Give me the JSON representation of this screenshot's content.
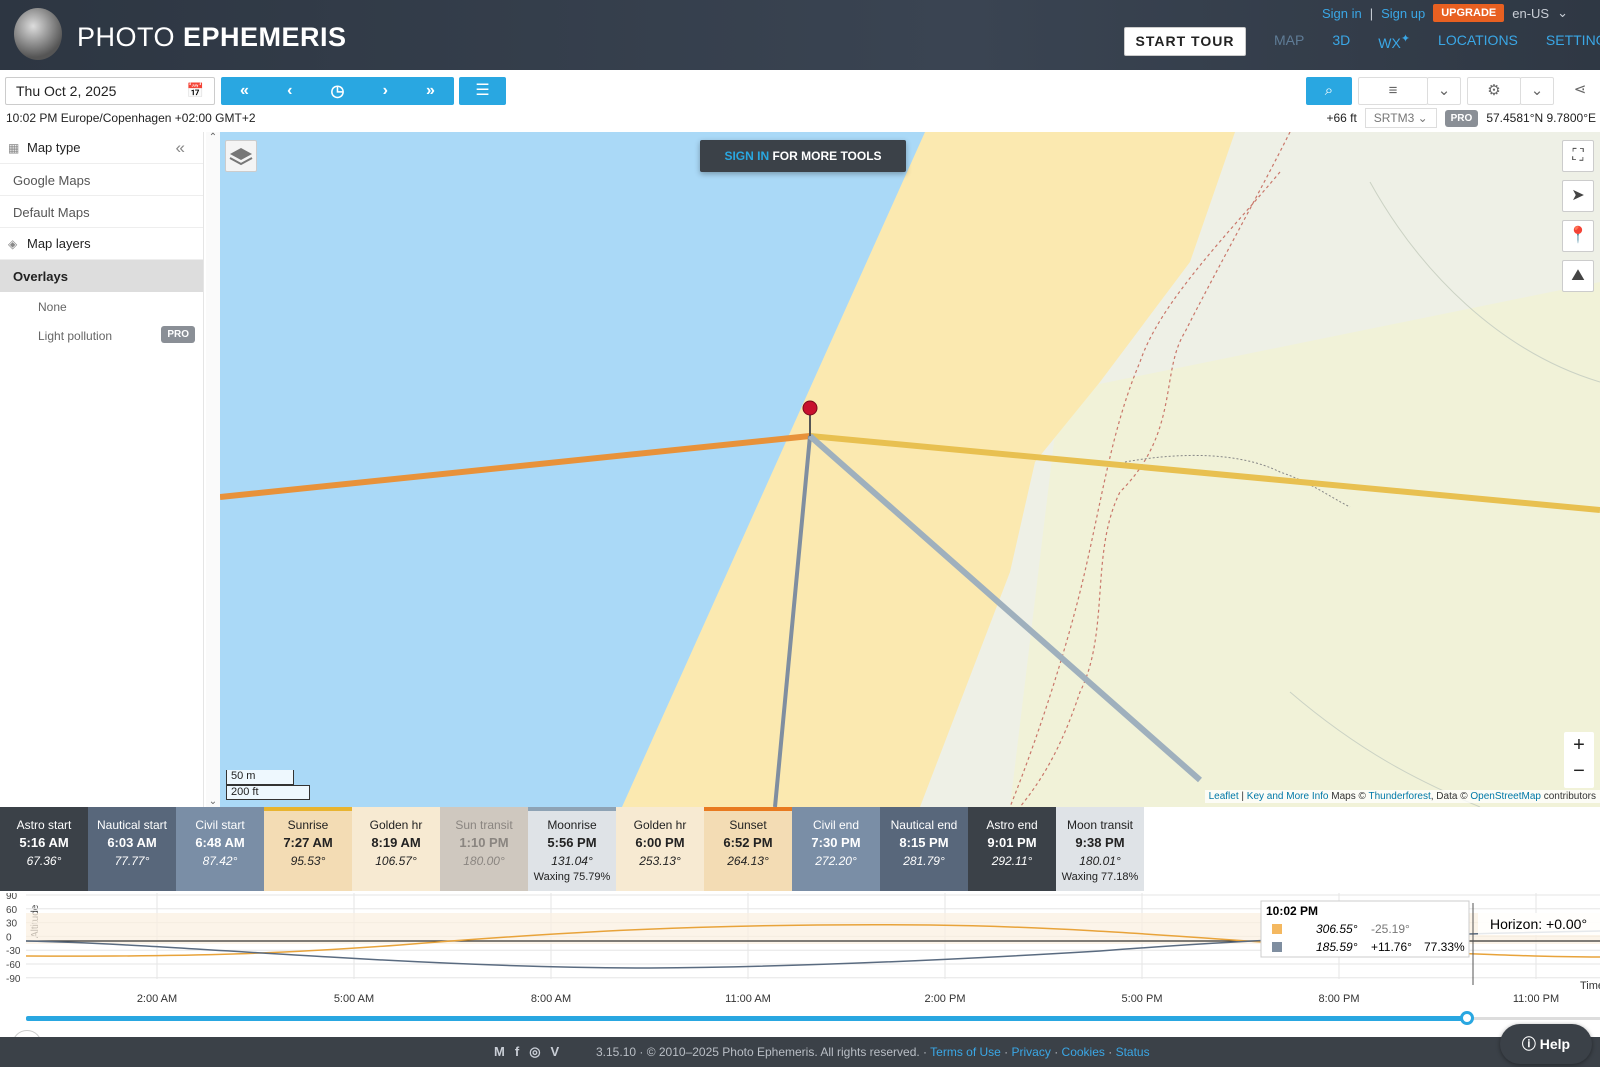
{
  "header": {
    "logo_light": "PHOTO",
    "logo_bold": "EPHEMERIS",
    "sign_in": "Sign in",
    "sep": "|",
    "sign_up": "Sign up",
    "upgrade": "UPGRADE",
    "language": "en-US",
    "start_tour": "START TOUR",
    "nav": {
      "map": "MAP",
      "three_d": "3D",
      "wx": "WX",
      "locations": "LOCATIONS",
      "settings": "SETTINGS"
    }
  },
  "toolbar": {
    "date": "Thu Oct 2, 2025",
    "timezone_line": "10:02 PM Europe/Copenhagen +02:00 GMT+2",
    "elevation": "+66 ft",
    "dem": "SRTM3",
    "pro": "PRO",
    "coords": "57.4581°N 9.7800°E"
  },
  "sidebar": {
    "map_type": "Map type",
    "google_maps": "Google Maps",
    "default_maps": "Default Maps",
    "map_layers": "Map layers",
    "overlays": "Overlays",
    "none": "None",
    "light_pollution": "Light pollution",
    "pro": "PRO"
  },
  "map": {
    "signin_prefix": "SIGN IN",
    "signin_suffix": " FOR MORE TOOLS",
    "scale_m": "50 m",
    "scale_ft": "200 ft",
    "attribution": {
      "leaflet": "Leaflet",
      "sep": " | ",
      "key": "Key and More Info",
      "maps": " Maps © ",
      "thunderforest": "Thunderforest",
      "data": ", Data © ",
      "osm": "OpenStreetMap",
      "contrib": " contributors"
    }
  },
  "events": [
    {
      "title": "Astro start",
      "time": "5:16 AM",
      "deg": "67.36°",
      "bg": "#3b4148",
      "fg": "#fff"
    },
    {
      "title": "Nautical start",
      "time": "6:03 AM",
      "deg": "77.77°",
      "bg": "#58677b",
      "fg": "#fff"
    },
    {
      "title": "Civil start",
      "time": "6:48 AM",
      "deg": "87.42°",
      "bg": "#7a8ea6",
      "fg": "#fff"
    },
    {
      "title": "Sunrise",
      "time": "7:27 AM",
      "deg": "95.53°",
      "bg": "#f3dcb4",
      "fg": "#222",
      "top": "#e8b430"
    },
    {
      "title": "Golden hr",
      "time": "8:19 AM",
      "deg": "106.57°",
      "bg": "#f7ead2",
      "fg": "#222"
    },
    {
      "title": "Sun transit",
      "time": "1:10 PM",
      "deg": "180.00°",
      "bg": "#cfc8bf",
      "fg": "#8a8580"
    },
    {
      "title": "Moonrise",
      "time": "5:56 PM",
      "deg": "131.04°",
      "extra": "Waxing 75.79%",
      "bg": "#dfe3e7",
      "fg": "#222",
      "top": "#8ea3b5"
    },
    {
      "title": "Golden hr",
      "time": "6:00 PM",
      "deg": "253.13°",
      "bg": "#f7ead2",
      "fg": "#222"
    },
    {
      "title": "Sunset",
      "time": "6:52 PM",
      "deg": "264.13°",
      "bg": "#f3dcb4",
      "fg": "#222",
      "top": "#e87a20"
    },
    {
      "title": "Civil end",
      "time": "7:30 PM",
      "deg": "272.20°",
      "bg": "#7a8ea6",
      "fg": "#fff"
    },
    {
      "title": "Nautical end",
      "time": "8:15 PM",
      "deg": "281.79°",
      "bg": "#58677b",
      "fg": "#fff"
    },
    {
      "title": "Astro end",
      "time": "9:01 PM",
      "deg": "292.11°",
      "bg": "#3b4148",
      "fg": "#fff"
    },
    {
      "title": "Moon transit",
      "time": "9:38 PM",
      "deg": "180.01°",
      "extra": "Waxing 77.18%",
      "bg": "#dfe3e7",
      "fg": "#222"
    }
  ],
  "chart": {
    "y_axis_label": "Altitude",
    "y_ticks": [
      "90",
      "60",
      "30",
      "0",
      "-30",
      "-60",
      "-90"
    ],
    "x_ticks": [
      "2:00 AM",
      "5:00 AM",
      "8:00 AM",
      "11:00 AM",
      "2:00 PM",
      "5:00 PM",
      "8:00 PM",
      "11:00 PM"
    ],
    "x_axis_label": "Time",
    "horizon": "Horizon: +0.00°",
    "tooltip": {
      "time": "10:02 PM",
      "sun_az": "306.55°",
      "sun_alt": "-25.19°",
      "moon_az": "185.59°",
      "moon_alt": "+11.76°",
      "moon_illum": "77.33%"
    }
  },
  "slider": {
    "position_fraction": 0.915
  },
  "footer": {
    "text": "3.15.10 · © 2010–2025 Photo Ephemeris. All rights reserved. · ",
    "terms": "Terms of Use",
    "privacy": "Privacy",
    "cookies": "Cookies",
    "status": "Status",
    "dot": " · ",
    "help": "Help"
  },
  "colors": {
    "accent": "#29a7e1",
    "sun": "#e8923a",
    "sunset": "#e8c050",
    "moon": "#8ea3b5",
    "water": "#aad9f7",
    "sand": "#fbe9b0"
  }
}
